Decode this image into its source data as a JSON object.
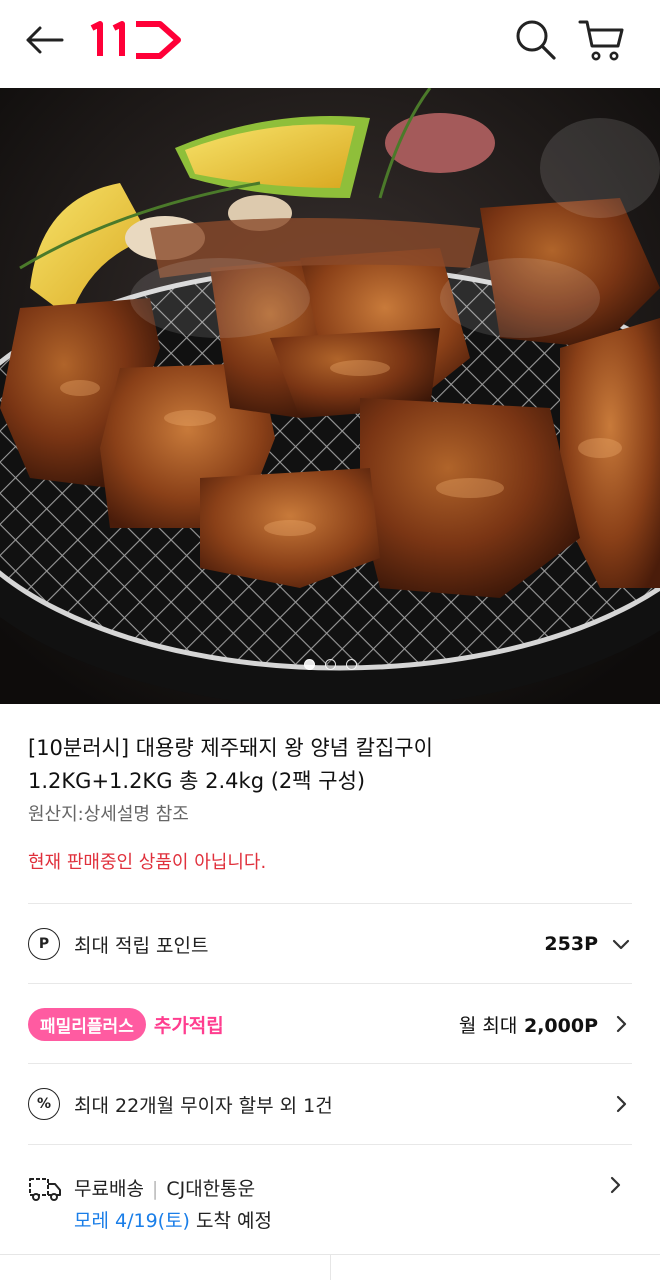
{
  "header": {
    "back_icon": "back-arrow-icon",
    "logo_text": "11",
    "search_icon": "search-icon",
    "cart_icon": "cart-icon",
    "brand_color": "#ff0038"
  },
  "gallery": {
    "image_description": "grilled marinated pork on a round grill with lemon and mushrooms",
    "slide_count": 3,
    "active_slide": 1
  },
  "product": {
    "title_line1": "[10분러시] 대용량 제주돼지 왕 양념 칼집구이",
    "title_line2": "1.2KG+1.2KG 총 2.4kg (2팩 구성)",
    "origin": "원산지:상세설명 참조",
    "notice": "현재 판매중인 상품이 아닙니다.",
    "notice_color": "#e0303c"
  },
  "points": {
    "icon_text": "P",
    "label": "최대 적립 포인트",
    "value": "253P"
  },
  "family": {
    "badge": "패밀리플러스",
    "extra": "추가적립",
    "value_prefix": "월 최대",
    "value": "2,000P",
    "badge_color": "#ff5ba1"
  },
  "installment": {
    "icon_text": "%",
    "label": "최대 22개월 무이자 할부 외 1건"
  },
  "delivery": {
    "free_label": "무료배송",
    "carrier": "CJ대한통운",
    "date_highlight": "모레 4/19(토)",
    "arrival": "도착 예정",
    "highlight_color": "#1a7ee8"
  }
}
